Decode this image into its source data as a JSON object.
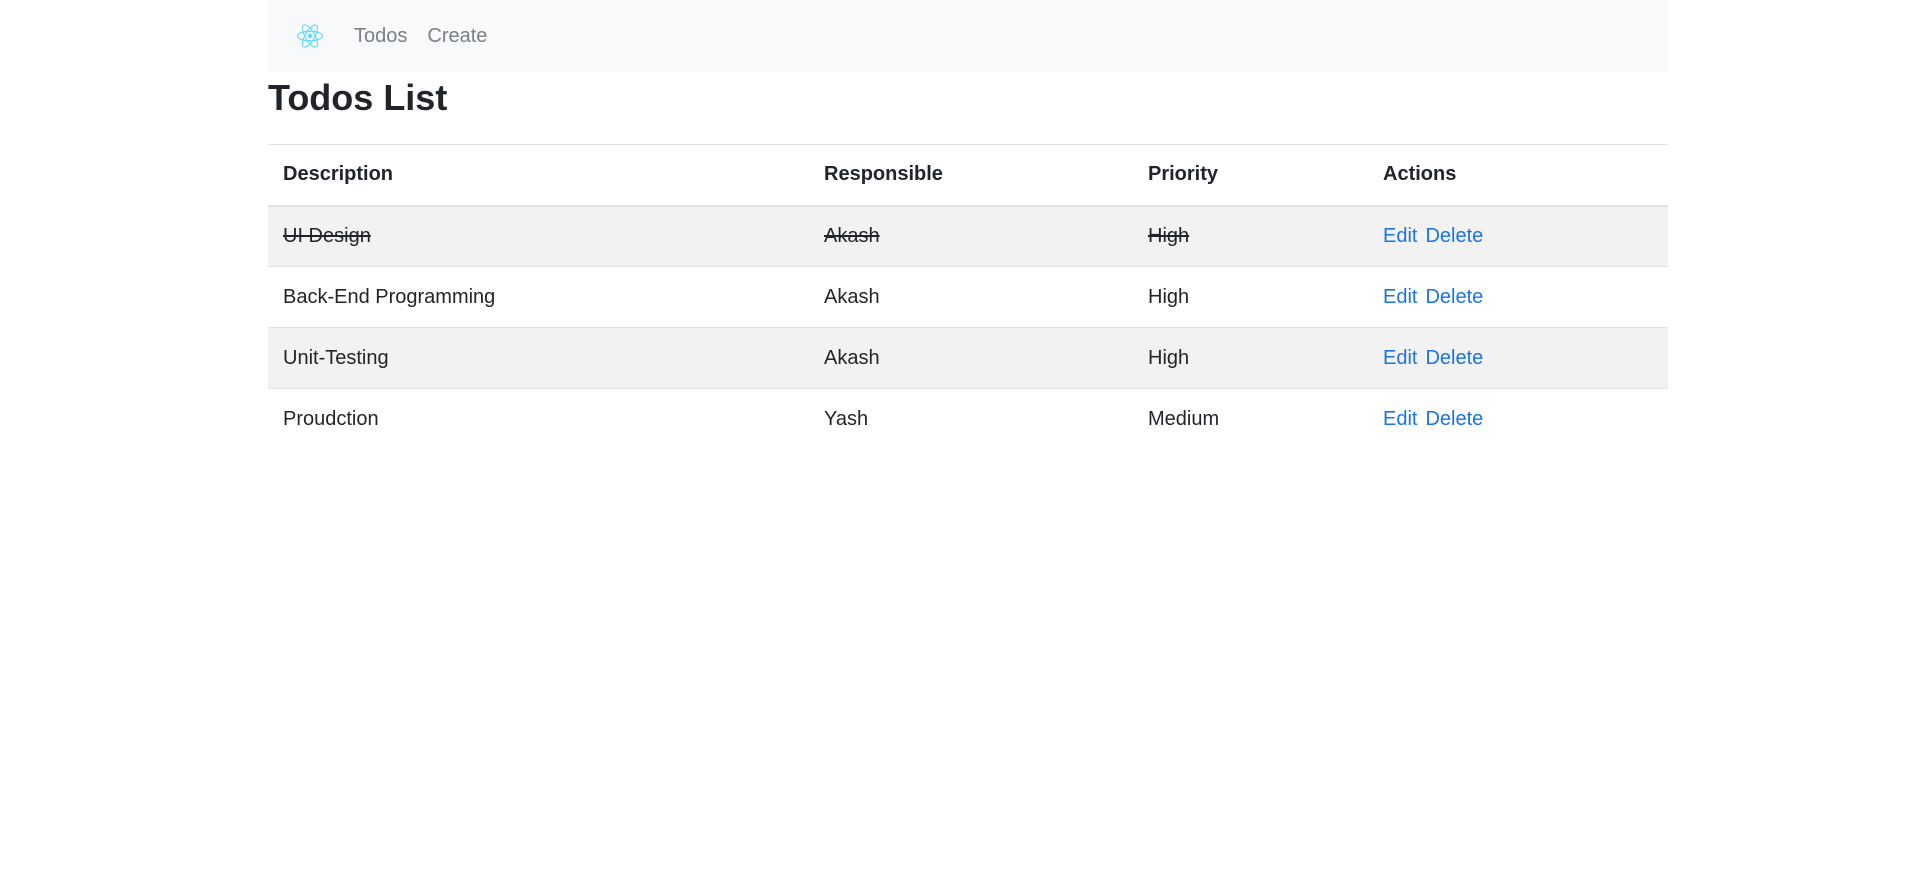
{
  "navbar": {
    "brand_icon": "react-logo-icon",
    "links": [
      "Todos",
      "Create"
    ]
  },
  "page": {
    "title": "Todos List"
  },
  "table": {
    "headers": [
      "Description",
      "Responsible",
      "Priority",
      "Actions"
    ],
    "rows": [
      {
        "description": "UI Design",
        "responsible": "Akash",
        "priority": "High",
        "completed": true,
        "edit": "Edit",
        "delete": "Delete"
      },
      {
        "description": "Back-End Programming",
        "responsible": "Akash",
        "priority": "High",
        "completed": false,
        "edit": "Edit",
        "delete": "Delete"
      },
      {
        "description": "Unit-Testing",
        "responsible": "Akash",
        "priority": "High",
        "completed": false,
        "edit": "Edit",
        "delete": "Delete"
      },
      {
        "description": "Proudction",
        "responsible": "Yash",
        "priority": "Medium",
        "completed": false,
        "edit": "Edit",
        "delete": "Delete"
      }
    ]
  },
  "colors": {
    "navbar_bg": "#f8f9fa",
    "link": "#1a73e8",
    "react_logo": "#61dafb",
    "striped_row": "#f2f2f2"
  }
}
